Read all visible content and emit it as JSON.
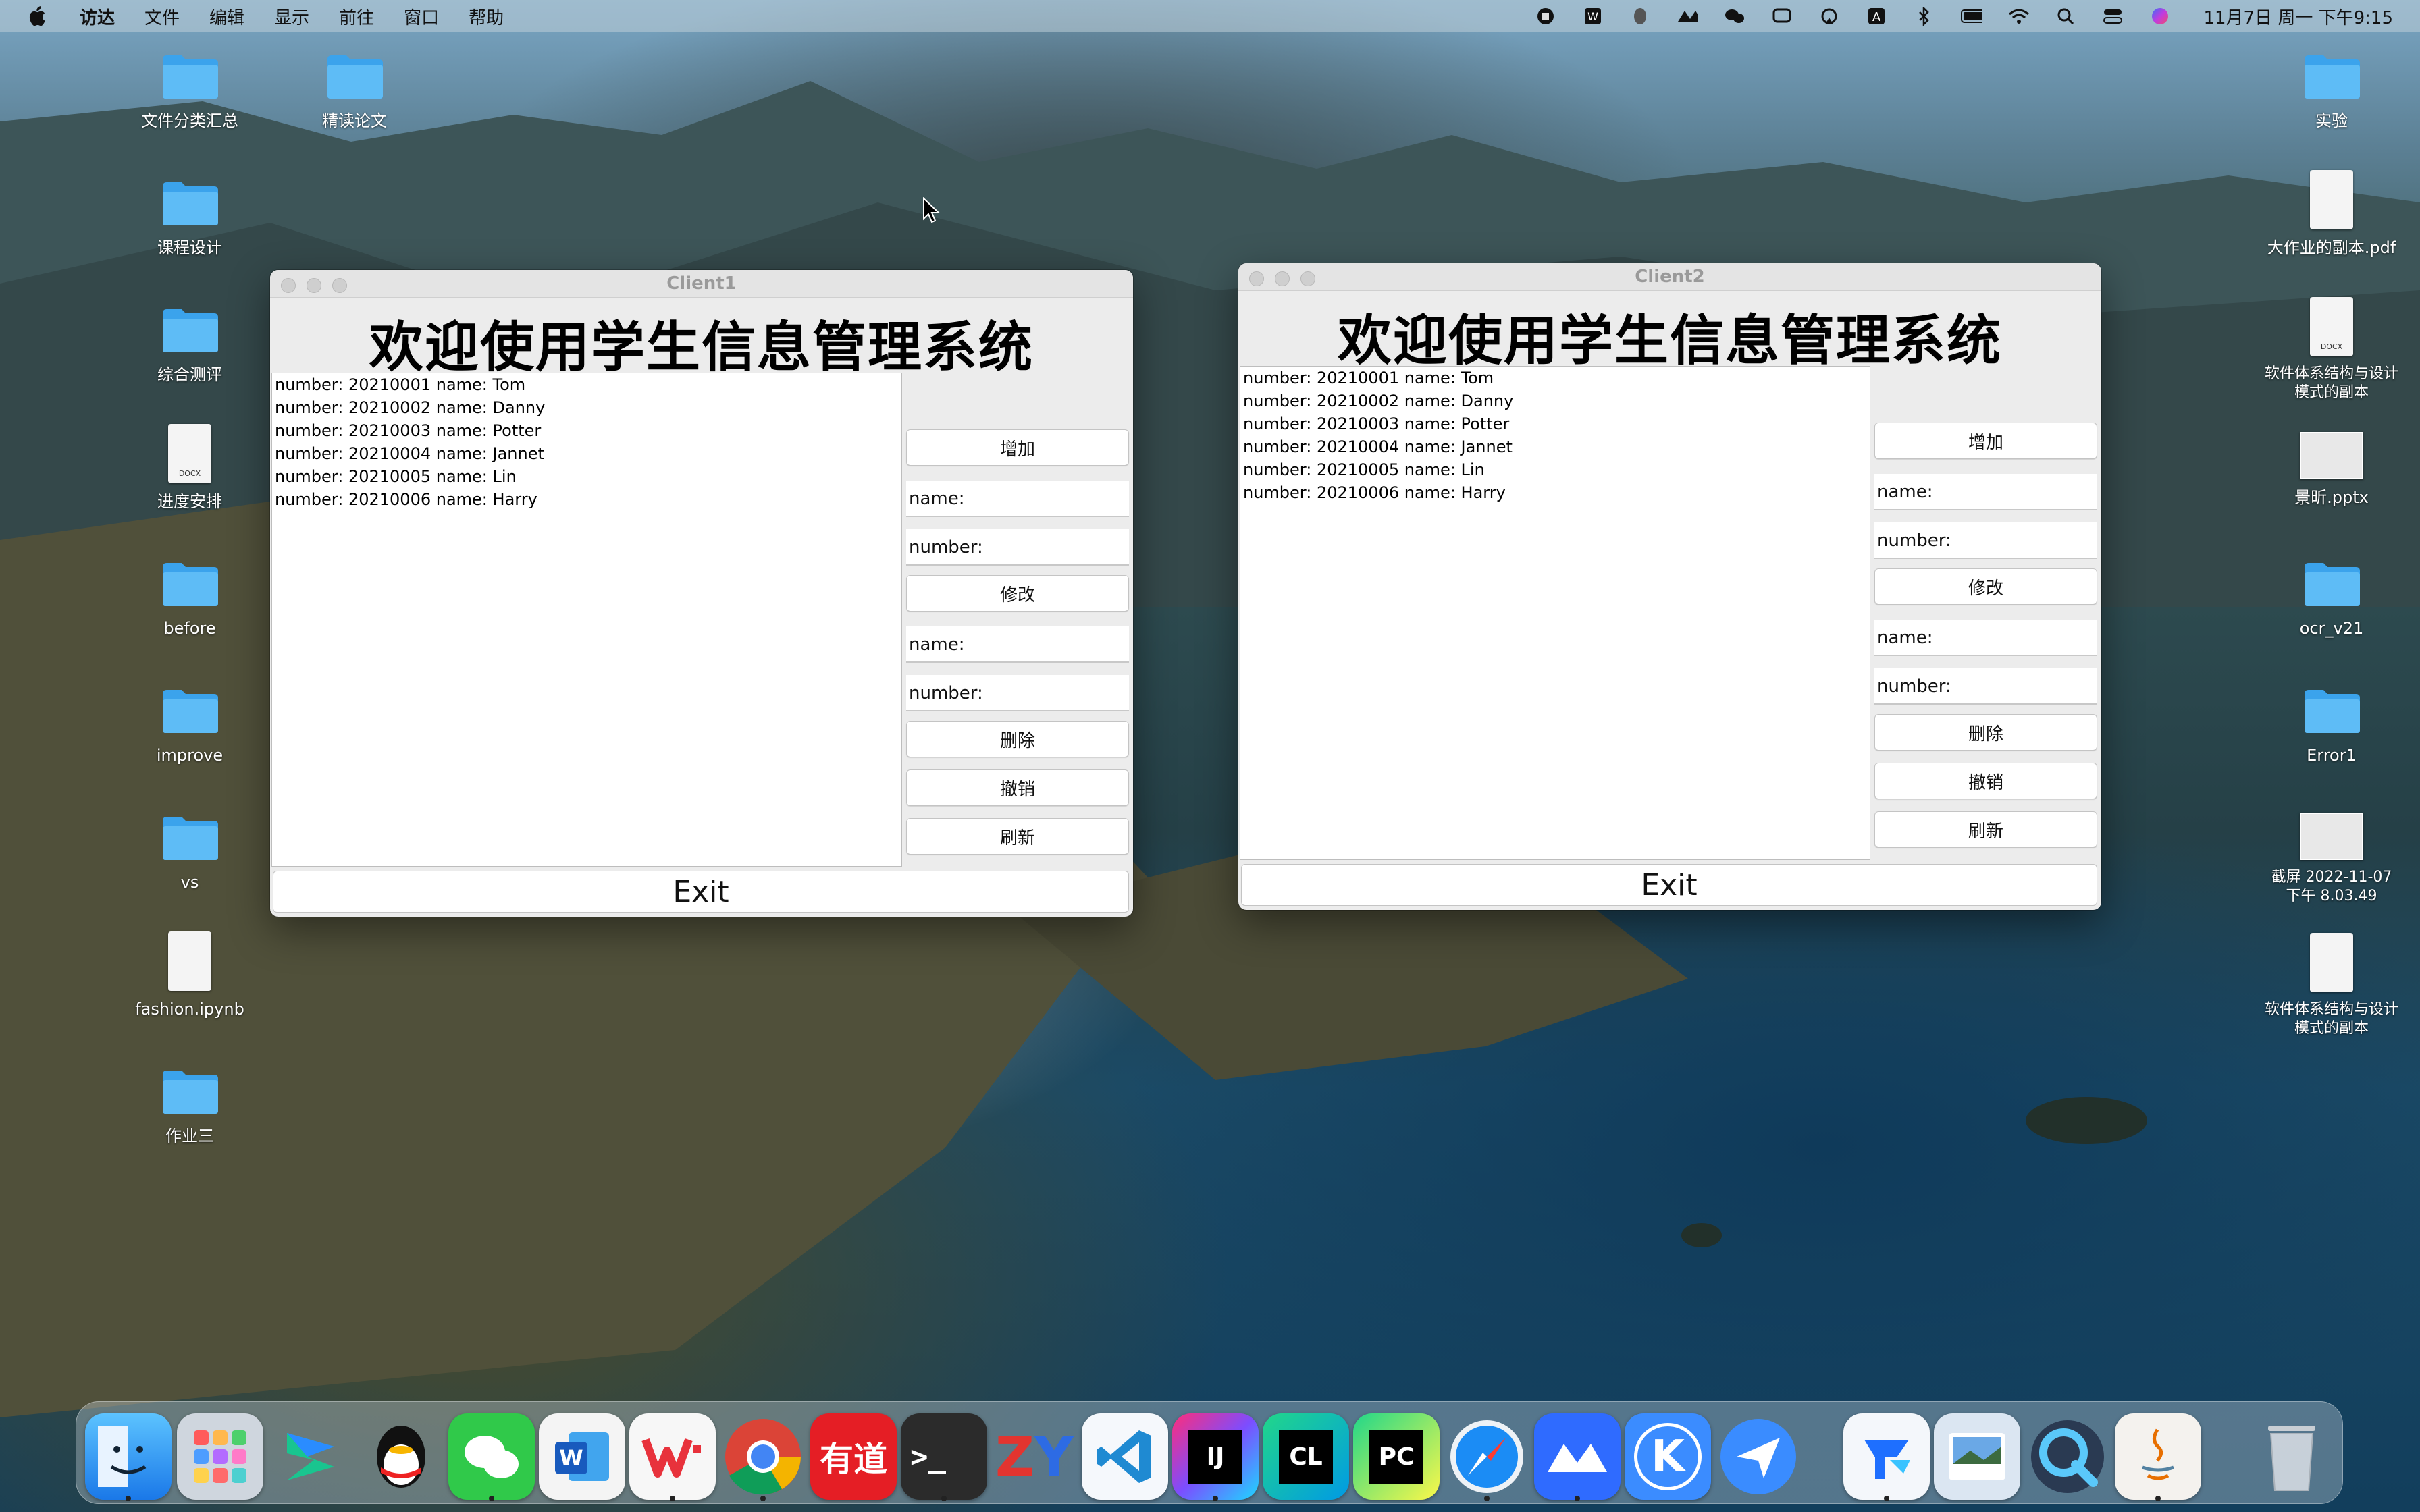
{
  "menubar": {
    "app_name": "访达",
    "items": [
      "文件",
      "编辑",
      "显示",
      "前往",
      "窗口",
      "帮助"
    ],
    "clock": "11月7日 周一 下午9:15"
  },
  "desktop_left": [
    {
      "label": "文件分类汇总",
      "kind": "folder"
    },
    {
      "label": "精读论文",
      "kind": "folder"
    },
    {
      "label": "课程设计",
      "kind": "folder"
    },
    {
      "label": "综合测评",
      "kind": "folder"
    },
    {
      "label": "进度安排",
      "kind": "docx"
    },
    {
      "label": "before",
      "kind": "folder"
    },
    {
      "label": "improve",
      "kind": "folder"
    },
    {
      "label": "vs",
      "kind": "folder"
    },
    {
      "label": "fashion.ipynb",
      "kind": "file"
    },
    {
      "label": "作业三",
      "kind": "folder"
    }
  ],
  "desktop_right": [
    {
      "label": "实验",
      "kind": "folder"
    },
    {
      "label": "大作业的副本.pdf",
      "kind": "pdf"
    },
    {
      "label": "软件体系结构与设计模式的副本",
      "kind": "docx"
    },
    {
      "label": "景昕.pptx",
      "kind": "pptx"
    },
    {
      "label": "ocr_v21",
      "kind": "folder"
    },
    {
      "label": "Error1",
      "kind": "folder"
    },
    {
      "label": "截屏 2022-11-07 下午 8.03.49",
      "kind": "image"
    },
    {
      "label": "软件体系结构与设计模式的副本",
      "kind": "docx"
    }
  ],
  "doc_tag": "DOCX",
  "windows": [
    {
      "title": "Client1",
      "heading": "欢迎使用学生信息管理系统",
      "rows": [
        "number: 20210001 name: Tom",
        "number: 20210002 name: Danny",
        "number: 20210003 name: Potter",
        "number: 20210004 name: Jannet",
        "number: 20210005 name: Lin",
        "number: 20210006 name: Harry"
      ],
      "add_label": "增加",
      "name_label": "name:",
      "number_label": "number:",
      "modify_label": "修改",
      "delete_label": "删除",
      "undo_label": "撤销",
      "refresh_label": "刷新",
      "exit_label": "Exit"
    },
    {
      "title": "Client2",
      "heading": "欢迎使用学生信息管理系统",
      "rows": [
        "number: 20210001 name: Tom",
        "number: 20210002 name: Danny",
        "number: 20210003 name: Potter",
        "number: 20210004 name: Jannet",
        "number: 20210005 name: Lin",
        "number: 20210006 name: Harry"
      ],
      "add_label": "增加",
      "name_label": "name:",
      "number_label": "number:",
      "modify_label": "修改",
      "delete_label": "删除",
      "undo_label": "撤销",
      "refresh_label": "刷新",
      "exit_label": "Exit"
    }
  ],
  "dock": {
    "apps": [
      "finder-icon",
      "launchpad-icon",
      "swift-app-icon",
      "qq-icon",
      "wechat-icon",
      "word-icon",
      "wps-icon",
      "chrome-icon",
      "youdao-icon",
      "terminal-icon",
      "zy-icon",
      "vscode-icon",
      "intellij-icon",
      "clion-icon",
      "pycharm-icon",
      "safari-icon",
      "lark-icon",
      "k-app-icon",
      "feishu-icon",
      "tencent-docs-icon",
      "preview-icon",
      "quicktime-icon",
      "java-icon",
      "trash-icon"
    ],
    "labels": {
      "youdao": "有道",
      "terminal": ">_",
      "zy": "ZY",
      "ij": "IJ",
      "cl": "CL",
      "pc": "PC",
      "k": "K",
      "word": "W"
    }
  }
}
